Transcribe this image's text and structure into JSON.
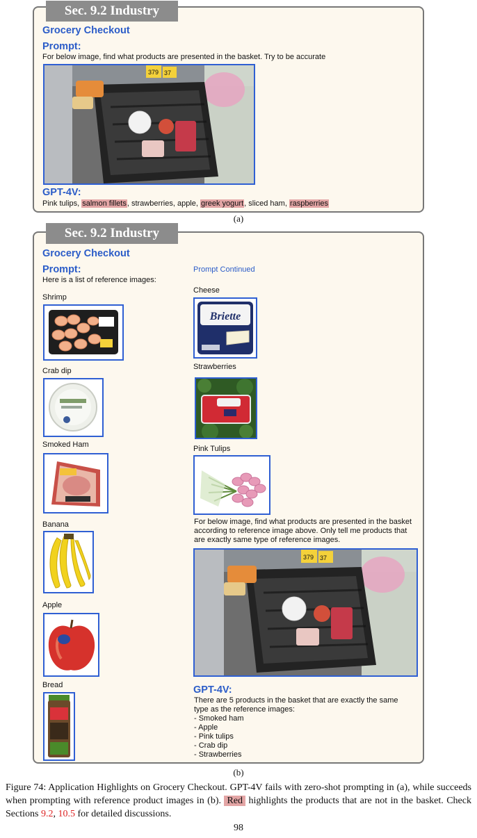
{
  "panel_a": {
    "section_tab": "Sec. 9.2 Industry",
    "title": "Grocery Checkout",
    "prompt_heading": "Prompt:",
    "prompt_text": "For below image, find what products are presented in the basket. Try to be accurate",
    "answer_heading": "GPT-4V:",
    "answer_parts": {
      "p1": "Pink tulips, ",
      "p2": "salmon fillets",
      "p3": ", strawberries, apple, ",
      "p4": "greek yogurt",
      "p5": ", sliced ham, ",
      "p6": "raspberries"
    },
    "label": "(a)"
  },
  "panel_b": {
    "section_tab": "Sec. 9.2 Industry",
    "title": "Grocery Checkout",
    "prompt_heading": "Prompt:",
    "prompt_intro": "Here is a list of reference images:",
    "prompt_continued": "Prompt Continued",
    "ref_left": {
      "shrimp": "Shrimp",
      "crab_dip": "Crab dip",
      "smoked_ham": "Smoked Ham",
      "banana": "Banana",
      "apple": "Apple",
      "bread": "Bread"
    },
    "ref_right": {
      "cheese": "Cheese",
      "strawberries": "Strawberries",
      "pink_tulips": "Pink Tulips"
    },
    "question_lines": [
      "For below image, find what products are presented in the basket",
      "according to reference image above. Only tell me products that",
      "are exactly same type of reference images."
    ],
    "answer_heading": "GPT-4V:",
    "answer_lines": [
      "There are 5 products in the basket that are exactly the same",
      "type as the reference images:",
      "- Smoked ham",
      "- Apple",
      "- Pink tulips",
      "- Crab dip",
      "- Strawberries"
    ],
    "image_text": {
      "brie_brand": "Briette",
      "price_1": "379",
      "price_2": "37"
    },
    "label": "(b)"
  },
  "caption": {
    "p1": "Figure 74: Application Highlights on Grocery Checkout. GPT-4V fails with zero-shot prompting in (a), while succeeds when prompting with reference product images in (b). ",
    "red_label": "Red",
    "p2": " highlights the products that are not in the basket. Check Sections ",
    "ref1": "9.2",
    "p3": ", ",
    "ref2": "10.5",
    "p4": " for detailed discussions."
  },
  "page_number": "98",
  "colors": {
    "accent_blue": "#2b5cc8",
    "image_border": "#2f5fd3",
    "highlight_red": "#e3a5a5",
    "panel_bg": "#fdf8ee",
    "tab_gray": "#8c8c8c"
  }
}
